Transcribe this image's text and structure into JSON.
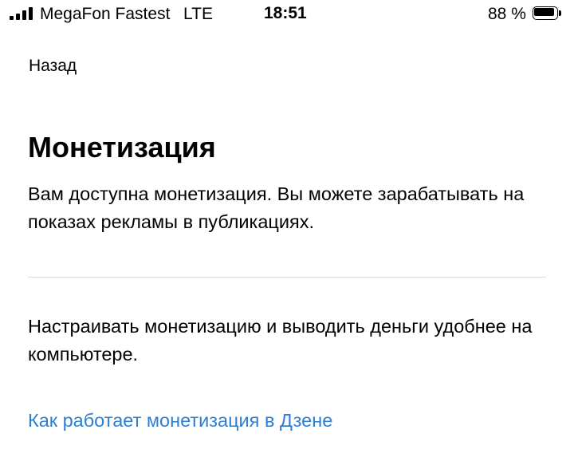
{
  "status_bar": {
    "carrier": "MegaFon Fastest",
    "network": "LTE",
    "time": "18:51",
    "battery_percent": "88 %",
    "battery_level": 0.88
  },
  "navigation": {
    "back_label": "Назад"
  },
  "main": {
    "title": "Монетизация",
    "description": "Вам доступна монетизация. Вы можете зарабатывать на показах рекламы в публикациях.",
    "desktop_note": "Настраивать монетизацию и выводить деньги удобнее на компьютере.",
    "help_link": "Как работает монетизация в Дзене"
  },
  "colors": {
    "link": "#2d7fd3",
    "divider": "#dcdcdc",
    "text": "#000000",
    "background": "#ffffff"
  }
}
